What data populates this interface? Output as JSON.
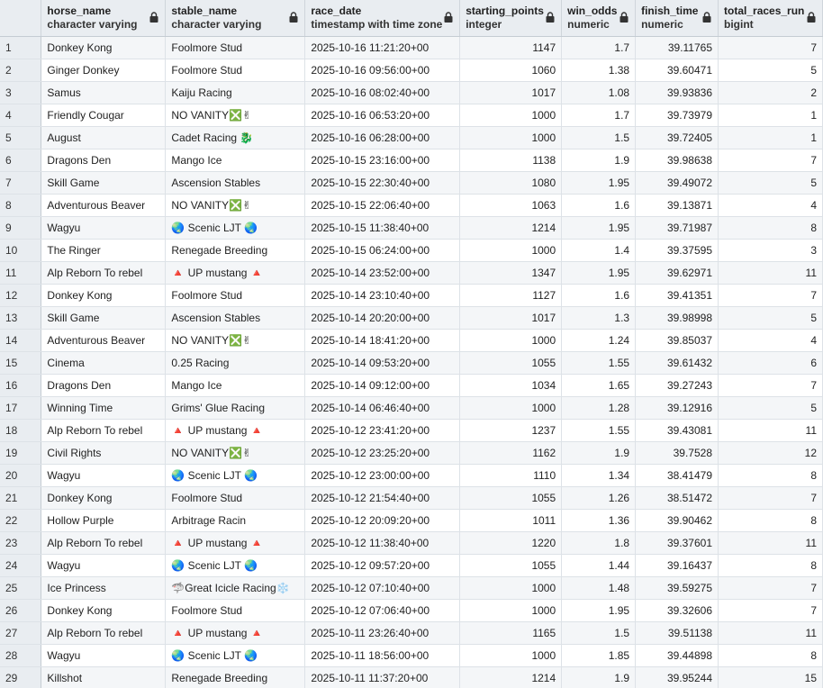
{
  "columns": [
    {
      "name": "horse_name",
      "type": "character varying",
      "align": "left"
    },
    {
      "name": "stable_name",
      "type": "character varying",
      "align": "left"
    },
    {
      "name": "race_date",
      "type": "timestamp with time zone",
      "align": "left"
    },
    {
      "name": "starting_points",
      "type": "integer",
      "align": "right"
    },
    {
      "name": "win_odds",
      "type": "numeric",
      "align": "right"
    },
    {
      "name": "finish_time",
      "type": "numeric",
      "align": "right"
    },
    {
      "name": "total_races_run",
      "type": "bigint",
      "align": "right"
    }
  ],
  "rows": [
    [
      "1",
      "Donkey  Kong",
      "Foolmore Stud",
      "2025-10-16 11:21:20+00",
      "1147",
      "1.7",
      "39.11765",
      "7"
    ],
    [
      "2",
      "Ginger Donkey",
      "Foolmore Stud",
      "2025-10-16 09:56:00+00",
      "1060",
      "1.38",
      "39.60471",
      "5"
    ],
    [
      "3",
      "Samus",
      "Kaiju Racing",
      "2025-10-16 08:02:40+00",
      "1017",
      "1.08",
      "39.93836",
      "2"
    ],
    [
      "4",
      "Friendly Cougar",
      "NO VANITY❎✌",
      "2025-10-16 06:53:20+00",
      "1000",
      "1.7",
      "39.73979",
      "1"
    ],
    [
      "5",
      "August",
      "Cadet Racing 🐉",
      "2025-10-16 06:28:00+00",
      "1000",
      "1.5",
      "39.72405",
      "1"
    ],
    [
      "6",
      "Dragons Den",
      "Mango Ice",
      "2025-10-15 23:16:00+00",
      "1138",
      "1.9",
      "39.98638",
      "7"
    ],
    [
      "7",
      "Skill Game",
      "Ascension Stables",
      "2025-10-15 22:30:40+00",
      "1080",
      "1.95",
      "39.49072",
      "5"
    ],
    [
      "8",
      "Adventurous Beaver",
      "NO VANITY❎✌",
      "2025-10-15 22:06:40+00",
      "1063",
      "1.6",
      "39.13871",
      "4"
    ],
    [
      "9",
      "Wagyu",
      "🌏 Scenic LJT 🌏",
      "2025-10-15 11:38:40+00",
      "1214",
      "1.95",
      "39.71987",
      "8"
    ],
    [
      "10",
      "The Ringer",
      "Renegade Breeding",
      "2025-10-15 06:24:00+00",
      "1000",
      "1.4",
      "39.37595",
      "3"
    ],
    [
      "11",
      "Alp Reborn To rebel",
      "🔺 UP mustang 🔺",
      "2025-10-14 23:52:00+00",
      "1347",
      "1.95",
      "39.62971",
      "11"
    ],
    [
      "12",
      "Donkey  Kong",
      "Foolmore Stud",
      "2025-10-14 23:10:40+00",
      "1127",
      "1.6",
      "39.41351",
      "7"
    ],
    [
      "13",
      "Skill Game",
      "Ascension Stables",
      "2025-10-14 20:20:00+00",
      "1017",
      "1.3",
      "39.98998",
      "5"
    ],
    [
      "14",
      "Adventurous Beaver",
      "NO VANITY❎✌",
      "2025-10-14 18:41:20+00",
      "1000",
      "1.24",
      "39.85037",
      "4"
    ],
    [
      "15",
      "Cinema",
      "0.25 Racing",
      "2025-10-14 09:53:20+00",
      "1055",
      "1.55",
      "39.61432",
      "6"
    ],
    [
      "16",
      "Dragons Den",
      "Mango Ice",
      "2025-10-14 09:12:00+00",
      "1034",
      "1.65",
      "39.27243",
      "7"
    ],
    [
      "17",
      "Winning Time",
      "Grims' Glue Racing",
      "2025-10-14 06:46:40+00",
      "1000",
      "1.28",
      "39.12916",
      "5"
    ],
    [
      "18",
      "Alp Reborn To rebel",
      "🔺 UP mustang 🔺",
      "2025-10-12 23:41:20+00",
      "1237",
      "1.55",
      "39.43081",
      "11"
    ],
    [
      "19",
      "Civil Rights",
      "NO VANITY❎✌",
      "2025-10-12 23:25:20+00",
      "1162",
      "1.9",
      "39.7528",
      "12"
    ],
    [
      "20",
      "Wagyu",
      "🌏 Scenic LJT 🌏",
      "2025-10-12 23:00:00+00",
      "1110",
      "1.34",
      "38.41479",
      "8"
    ],
    [
      "21",
      "Donkey  Kong",
      "Foolmore Stud",
      "2025-10-12 21:54:40+00",
      "1055",
      "1.26",
      "38.51472",
      "7"
    ],
    [
      "22",
      "Hollow Purple",
      "Arbitrage Racin",
      "2025-10-12 20:09:20+00",
      "1011",
      "1.36",
      "39.90462",
      "8"
    ],
    [
      "23",
      "Alp Reborn To rebel",
      "🔺 UP mustang 🔺",
      "2025-10-12 11:38:40+00",
      "1220",
      "1.8",
      "39.37601",
      "11"
    ],
    [
      "24",
      "Wagyu",
      "🌏 Scenic LJT 🌏",
      "2025-10-12 09:57:20+00",
      "1055",
      "1.44",
      "39.16437",
      "8"
    ],
    [
      "25",
      "Ice Princess",
      "🦈Great Icicle Racing❄️",
      "2025-10-12 07:10:40+00",
      "1000",
      "1.48",
      "39.59275",
      "7"
    ],
    [
      "26",
      "Donkey  Kong",
      "Foolmore Stud",
      "2025-10-12 07:06:40+00",
      "1000",
      "1.95",
      "39.32606",
      "7"
    ],
    [
      "27",
      "Alp Reborn To rebel",
      "🔺 UP mustang 🔺",
      "2025-10-11 23:26:40+00",
      "1165",
      "1.5",
      "39.51138",
      "11"
    ],
    [
      "28",
      "Wagyu",
      "🌏 Scenic LJT 🌏",
      "2025-10-11 18:56:00+00",
      "1000",
      "1.85",
      "39.44898",
      "8"
    ],
    [
      "29",
      "Killshot",
      "Renegade Breeding",
      "2025-10-11 11:37:20+00",
      "1214",
      "1.9",
      "39.95244",
      "15"
    ]
  ]
}
